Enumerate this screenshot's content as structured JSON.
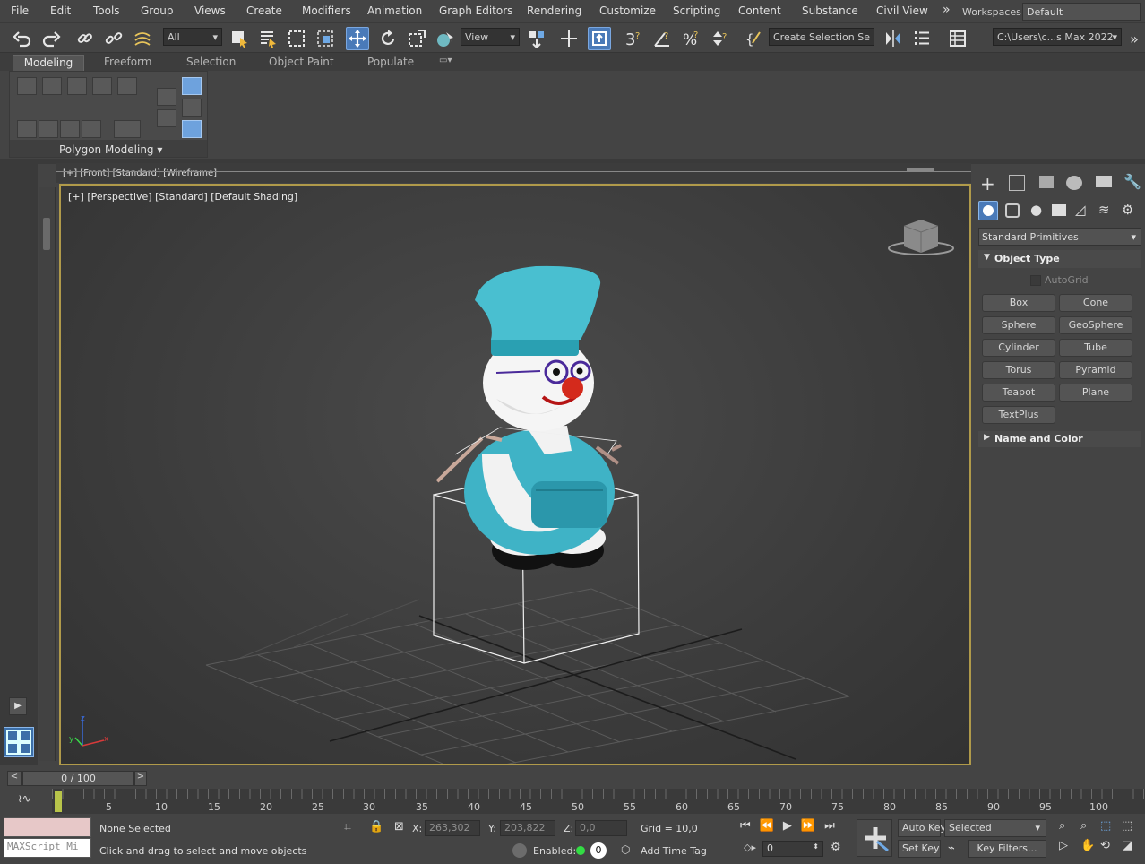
{
  "menu": {
    "items": [
      "File",
      "Edit",
      "Tools",
      "Group",
      "Views",
      "Create",
      "Modifiers",
      "Animation",
      "Graph Editors",
      "Rendering",
      "Customize",
      "Scripting",
      "Content",
      "Substance",
      "Civil View"
    ],
    "overflow_glyph": "»",
    "workspaces_label": "Workspaces:",
    "workspace_value": "Default"
  },
  "toolbar": {
    "filter_value": "All",
    "ref_coord_value": "View",
    "named_selection_value": "Create Selection Se",
    "project_path": "C:\\Users\\c...s Max 2022",
    "icons": [
      "undo-icon",
      "redo-icon",
      "link-icon",
      "unlink-icon",
      "bind-spacewarp-icon",
      "select-object-icon",
      "select-by-name-icon",
      "rectangle-selection-icon",
      "window-crossing-icon",
      "select-move-icon",
      "select-rotate-icon",
      "select-scale-icon",
      "placement-icon",
      "pivot-icon",
      "snap-3d-icon",
      "angle-snap-icon",
      "percent-snap-icon",
      "spinner-snap-icon",
      "edit-named-sets-icon",
      "mirror-icon",
      "align-icon",
      "layers-icon",
      "scene-explorer-icon"
    ]
  },
  "ribbon": {
    "tabs": [
      "Modeling",
      "Freeform",
      "Selection",
      "Object Paint",
      "Populate"
    ],
    "active_tab": "Modeling",
    "panel_title": "Polygon Modeling"
  },
  "viewports": {
    "front_label": "[+] [Front] [Standard] [Wireframe]",
    "main_label_plus": "[+]",
    "main_label_view": "[Perspective]",
    "main_label_standard": "[Standard]",
    "main_label_shading": "[Default Shading]",
    "axis_labels": {
      "z": "z",
      "x": "x",
      "y": "y"
    }
  },
  "command_panel": {
    "category": "Standard Primitives",
    "object_type_title": "Object Type",
    "autogrid_label": "AutoGrid",
    "buttons": [
      "Box",
      "Cone",
      "Sphere",
      "GeoSphere",
      "Cylinder",
      "Tube",
      "Torus",
      "Pyramid",
      "Teapot",
      "Plane",
      "TextPlus"
    ],
    "name_color_title": "Name and Color"
  },
  "timeline": {
    "slider_label": "0 / 100",
    "frame_ticks": [
      "5",
      "10",
      "15",
      "20",
      "25",
      "30",
      "35",
      "40",
      "45",
      "50",
      "55",
      "60",
      "65",
      "70",
      "75",
      "80",
      "85",
      "90",
      "95",
      "100"
    ]
  },
  "status": {
    "maxscript_placeholder": "MAXScript Mi",
    "selection_status": "None Selected",
    "prompt": "Click and drag to select and move objects",
    "x_label": "X:",
    "x_value": "263,302",
    "y_label": "Y:",
    "y_value": "203,822",
    "z_label": "Z:",
    "z_value": "0,0",
    "grid_label": "Grid = 10,0",
    "enabled_label": "Enabled:",
    "enabled_value": "0",
    "add_time_tag": "Add Time Tag",
    "auto_key": "Auto Key",
    "set_key": "Set Key",
    "key_mode_value": "Selected",
    "key_filters": "Key Filters...",
    "current_frame": "0"
  },
  "colors": {
    "accent_blue": "#4a7ab8",
    "viewport_border": "#b09a4a",
    "character_cyan": "#3fb3c6",
    "nose_red": "#d42a1c"
  }
}
